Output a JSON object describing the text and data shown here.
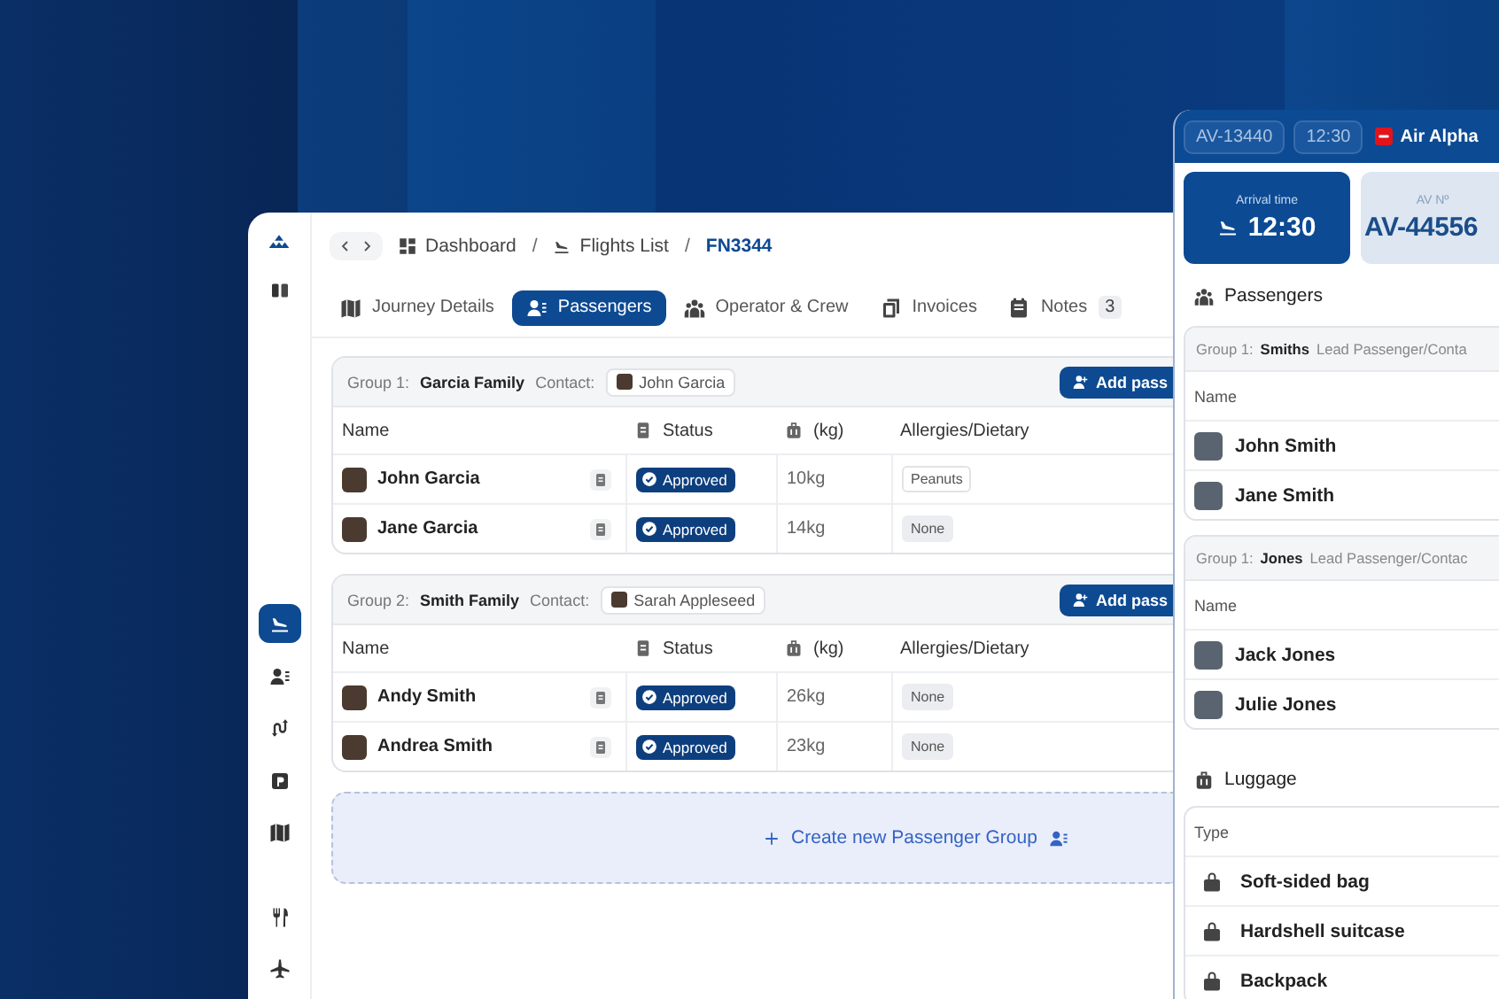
{
  "main": {
    "breadcrumbs": [
      {
        "label": "Dashboard",
        "selected": false
      },
      {
        "label": "Flights List",
        "selected": false
      },
      {
        "label": "FN3344",
        "selected": true
      }
    ],
    "separators": [
      "/",
      "/"
    ],
    "rail": [
      {
        "selected": true
      },
      {
        "selected": false
      },
      {
        "selected": false
      },
      {
        "selected": false
      },
      {
        "selected": false
      },
      {
        "selected": false
      },
      {
        "selected": false
      }
    ],
    "tabs": [
      {
        "label": "Journey Details",
        "selected": false
      },
      {
        "label": "Passengers",
        "selected": true
      },
      {
        "label": "Operator & Crew",
        "selected": false
      },
      {
        "label": "Invoices",
        "selected": false
      },
      {
        "label": "Notes",
        "count": "3",
        "selected": false
      }
    ],
    "groups": [
      {
        "group_label": "Group 1:",
        "name": "Garcia Family",
        "contact_label": "Contact:",
        "contact": "John Garcia",
        "button": "Add pass",
        "columns": [
          "Name",
          "Status",
          "(kg)",
          "Allergies/Dietary"
        ],
        "rows": [
          {
            "name": "John Garcia",
            "status": "Approved",
            "weight": "10kg",
            "allergy": {
              "label": "Peanuts",
              "kind": "listed"
            }
          },
          {
            "name": "Jane Garcia",
            "status": "Approved",
            "weight": "14kg",
            "allergy": {
              "label": "None",
              "kind": "none"
            }
          }
        ]
      },
      {
        "group_label": "Group 2:",
        "name": "Smith Family",
        "contact_label": "Contact:",
        "contact": "Sarah Appleseed",
        "button": "Add pass",
        "columns": [
          "Name",
          "Status",
          "(kg)",
          "Allergies/Dietary"
        ],
        "rows": [
          {
            "name": "Andy Smith",
            "status": "Approved",
            "weight": "26kg",
            "allergy": {
              "label": "None",
              "kind": "none"
            }
          },
          {
            "name": "Andrea Smith",
            "status": "Approved",
            "weight": "23kg",
            "allergy": {
              "label": "None",
              "kind": "none"
            }
          }
        ]
      }
    ],
    "create_group": "Create new Passenger Group"
  },
  "panel": {
    "chips": [
      "AV-13440",
      "12:30"
    ],
    "airline": "Air Alpha",
    "arrival": {
      "label": "Arrival time",
      "value": "12:30"
    },
    "av": {
      "label": "AV Nº",
      "value": "AV-44556"
    },
    "passengers_title": "Passengers",
    "groups": [
      {
        "group_label": "Group 1:",
        "name": "Smiths",
        "lead_label": "Lead Passenger/Conta",
        "column": "Name",
        "rows": [
          "John Smith",
          "Jane Smith"
        ]
      },
      {
        "group_label": "Group 1:",
        "name": "Jones",
        "lead_label": "Lead Passenger/Contac",
        "column": "Name",
        "rows": [
          "Jack Jones",
          "Julie Jones"
        ]
      }
    ],
    "luggage_title": "Luggage",
    "luggage_column": "Type",
    "luggage": [
      "Soft-sided bag",
      "Hardshell suitcase",
      "Backpack"
    ]
  }
}
